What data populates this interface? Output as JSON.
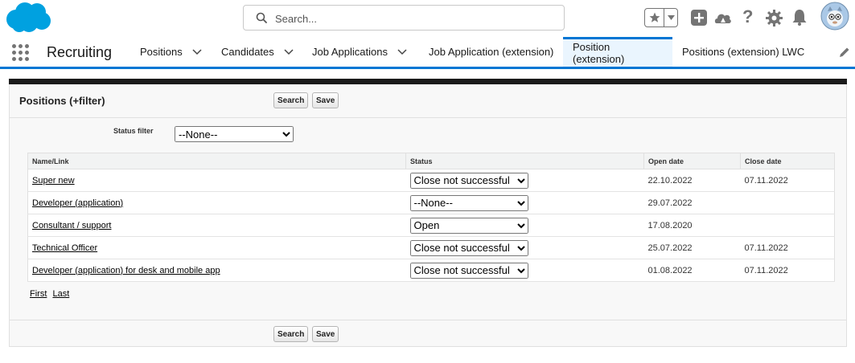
{
  "header": {
    "search_placeholder": "Search..."
  },
  "nav": {
    "app_name": "Recruiting",
    "tabs": [
      {
        "label": "Positions"
      },
      {
        "label": "Candidates"
      },
      {
        "label": "Job Applications"
      },
      {
        "label": "Job Application (extension)"
      },
      {
        "label": "Position (extension)"
      },
      {
        "label": "Positions (extension) LWC"
      }
    ]
  },
  "panel": {
    "title": "Positions (+filter)",
    "search_button": "Search",
    "save_button": "Save",
    "filter_label": "Status filter",
    "filter_value": "--None--",
    "status_options": [
      "--None--",
      "Open",
      "Close not successful"
    ],
    "columns": [
      "Name/Link",
      "Status",
      "Open date",
      "Close date"
    ],
    "rows": [
      {
        "name": "Super new",
        "status": "Close not successful",
        "open_date": "22.10.2022",
        "close_date": "07.11.2022"
      },
      {
        "name": "Developer (application)",
        "status": "--None--",
        "open_date": "29.07.2022",
        "close_date": ""
      },
      {
        "name": "Consultant / support",
        "status": "Open",
        "open_date": "17.08.2020",
        "close_date": ""
      },
      {
        "name": "Technical Officer",
        "status": "Close not successful",
        "open_date": "25.07.2022",
        "close_date": "07.11.2022"
      },
      {
        "name": "Developer (application) for desk and mobile app",
        "status": "Close not successful",
        "open_date": "01.08.2022",
        "close_date": "07.11.2022"
      }
    ],
    "pager": {
      "first": "First",
      "last": "Last"
    }
  },
  "colors": {
    "brand": "#0176d3",
    "logo": "#00a1e0"
  }
}
